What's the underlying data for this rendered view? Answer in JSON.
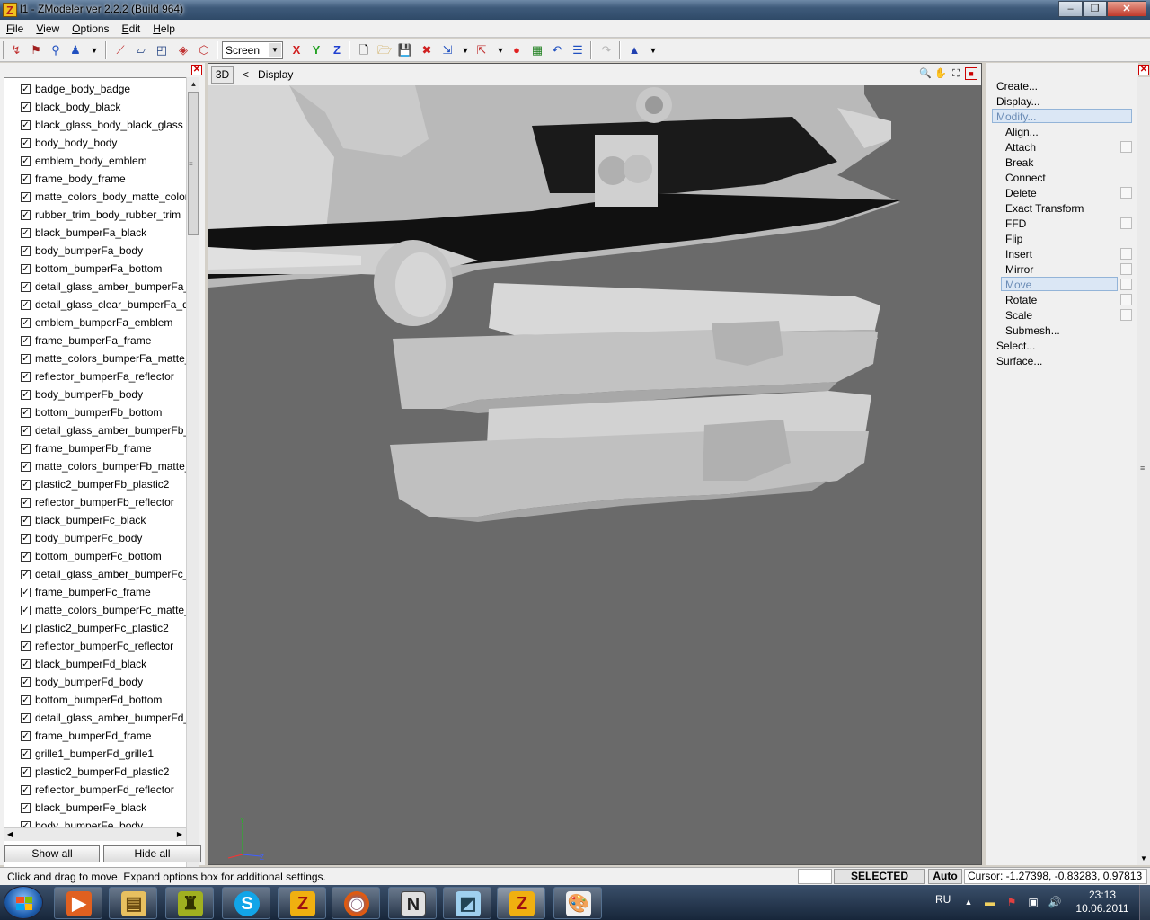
{
  "window": {
    "title": "l1 - ZModeler ver 2.2.2 (Build 964)",
    "minimize_icon": "minimize-icon",
    "maximize_icon": "restore-icon",
    "close_icon": "close-icon"
  },
  "menu": {
    "items": [
      "File",
      "View",
      "Options",
      "Edit",
      "Help"
    ]
  },
  "toolbar": {
    "view_select": "Screen",
    "axis_x": "X",
    "axis_y": "Y",
    "axis_z": "Z"
  },
  "objects": {
    "items": [
      "badge_body_badge",
      "black_body_black",
      "black_glass_body_black_glass",
      "body_body_body",
      "emblem_body_emblem",
      "frame_body_frame",
      "matte_colors_body_matte_color",
      "rubber_trim_body_rubber_trim",
      "black_bumperFa_black",
      "body_bumperFa_body",
      "bottom_bumperFa_bottom",
      "detail_glass_amber_bumperFa_c",
      "detail_glass_clear_bumperFa_de",
      "emblem_bumperFa_emblem",
      "frame_bumperFa_frame",
      "matte_colors_bumperFa_matte_",
      "reflector_bumperFa_reflector",
      "body_bumperFb_body",
      "bottom_bumperFb_bottom",
      "detail_glass_amber_bumperFb_c",
      "frame_bumperFb_frame",
      "matte_colors_bumperFb_matte_",
      "plastic2_bumperFb_plastic2",
      "reflector_bumperFb_reflector",
      "black_bumperFc_black",
      "body_bumperFc_body",
      "bottom_bumperFc_bottom",
      "detail_glass_amber_bumperFc_c",
      "frame_bumperFc_frame",
      "matte_colors_bumperFc_matte_",
      "plastic2_bumperFc_plastic2",
      "reflector_bumperFc_reflector",
      "black_bumperFd_black",
      "body_bumperFd_body",
      "bottom_bumperFd_bottom",
      "detail_glass_amber_bumperFd_c",
      "frame_bumperFd_frame",
      "grille1_bumperFd_grille1",
      "plastic2_bumperFd_plastic2",
      "reflector_bumperFd_reflector",
      "black_bumperFe_black",
      "body_bumperFe_body"
    ],
    "show_all": "Show all",
    "hide_all": "Hide all"
  },
  "viewport": {
    "tab_label": "3D",
    "back_glyph": "<",
    "display_label": "Display",
    "background": "#6a6a6a"
  },
  "commands": {
    "top": [
      "Create...",
      "Display...",
      "Modify..."
    ],
    "modify_items": [
      "Align...",
      "Attach",
      "Break",
      "Connect",
      "Delete",
      "Exact Transform",
      "FFD",
      "Flip",
      "Insert",
      "Mirror",
      "Move",
      "Rotate",
      "Scale",
      "Submesh..."
    ],
    "bottom": [
      "Select...",
      "Surface..."
    ],
    "selected": "Move"
  },
  "status": {
    "message": "Click and drag to move. Expand options box for additional settings.",
    "mode": "SELECTED MODE",
    "auto": "Auto",
    "cursor": "Cursor: -1.27398, -0.83283, 0.97813"
  },
  "taskbar": {
    "apps": [
      "media-player-icon",
      "file-explorer-icon",
      "game-app-icon",
      "skype-icon",
      "zmodeler-icon",
      "firefox-icon",
      "nvidia-icon",
      "notebook-icon",
      "zmodeler-icon",
      "paint-icon"
    ],
    "language": "RU",
    "time": "23:13",
    "date": "10.06.2011"
  },
  "colors": {
    "accent_selection": "#dbe7f5",
    "close_red": "#c0392b"
  }
}
